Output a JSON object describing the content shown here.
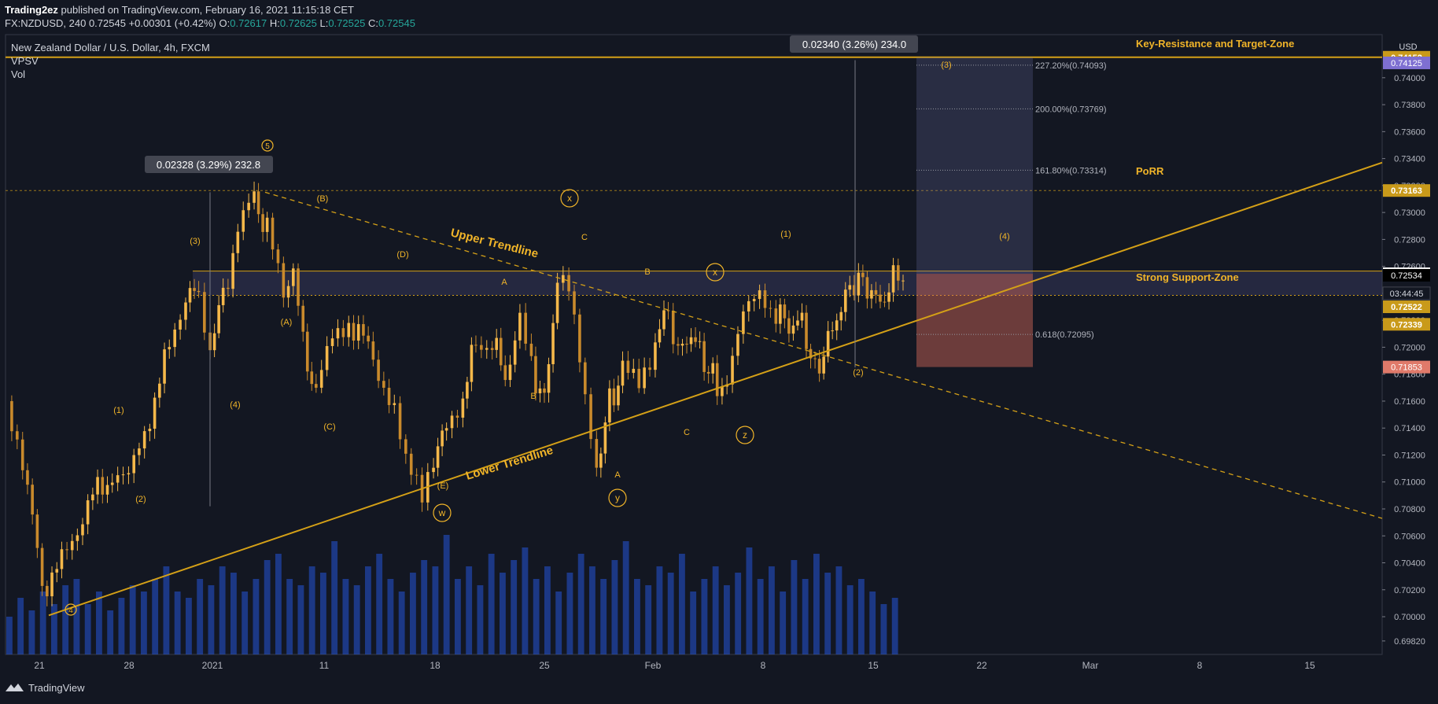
{
  "header": {
    "author": "Trading2ez",
    "published_text": "published on TradingView.com, February 16, 2021 11:15:18 CET",
    "symbol": "FX:NZDUSD, 240",
    "last": "0.72545",
    "change": "+0.00301 (+0.42%)",
    "o_label": "O:",
    "o": "0.72617",
    "h_label": "H:",
    "h": "0.72625",
    "l_label": "L:",
    "l": "0.72525",
    "c_label": "C:",
    "c": "0.72545"
  },
  "legend": {
    "title": "New Zealand Dollar / U.S. Dollar, 4h, FXCM",
    "indicator1": "VPSV",
    "indicator2": "Vol"
  },
  "footer": {
    "brand": "TradingView"
  },
  "colors": {
    "background": "#131722",
    "up_candle": "#f5b84a",
    "trendline": "#d4a017",
    "label_gold": "#f0b429",
    "volume": "#2962ff",
    "target_zone": "#6a6fa8",
    "stop_zone": "#d96a5a"
  },
  "chart_data": {
    "type": "candlestick",
    "symbol": "NZDUSD",
    "timeframe": "4h",
    "currency": "USD",
    "ylim": [
      0.6972,
      0.7432
    ],
    "x_ticks": [
      "21",
      "28",
      "2021",
      "11",
      "18",
      "25",
      "Feb",
      "8",
      "15",
      "22",
      "Mar",
      "8",
      "15"
    ],
    "y_ticks": [
      "0.74000",
      "0.73800",
      "0.73600",
      "0.73400",
      "0.73200",
      "0.73000",
      "0.72800",
      "0.72600",
      "0.72400",
      "0.72200",
      "0.72000",
      "0.71800",
      "0.71600",
      "0.71400",
      "0.71200",
      "0.71000",
      "0.70800",
      "0.70600",
      "0.70400",
      "0.70200",
      "0.70000",
      "0.69820"
    ],
    "price_tags": [
      {
        "value": "0.74152",
        "price": 0.74152,
        "kind": "gold"
      },
      {
        "value": "0.74125",
        "price": 0.7411,
        "kind": "purple"
      },
      {
        "value": "0.73163",
        "price": 0.73163,
        "kind": "gold"
      },
      {
        "value": "0.72545",
        "price": 0.72545,
        "kind": "white"
      },
      {
        "value": "03:44:45",
        "price": 0.724,
        "kind": "dark"
      },
      {
        "value": "0.72534",
        "price": 0.72534,
        "kind": "black"
      },
      {
        "value": "0.72522",
        "price": 0.723,
        "kind": "gold"
      },
      {
        "value": "0.72339",
        "price": 0.7217,
        "kind": "gold"
      },
      {
        "value": "0.71853",
        "price": 0.71853,
        "kind": "red"
      }
    ],
    "axis_currency": "USD",
    "price_path": [
      [
        0,
        0.716
      ],
      [
        10,
        0.712
      ],
      [
        22,
        0.7022
      ],
      [
        34,
        0.704
      ],
      [
        50,
        0.7085
      ],
      [
        65,
        0.7105
      ],
      [
        75,
        0.71
      ],
      [
        88,
        0.715
      ],
      [
        100,
        0.72
      ],
      [
        110,
        0.724
      ],
      [
        118,
        0.724
      ],
      [
        125,
        0.72
      ],
      [
        133,
        0.724
      ],
      [
        142,
        0.7285
      ],
      [
        152,
        0.731
      ],
      [
        160,
        0.7285
      ],
      [
        170,
        0.724
      ],
      [
        176,
        0.7262
      ],
      [
        182,
        0.72
      ],
      [
        190,
        0.7165
      ],
      [
        200,
        0.7205
      ],
      [
        210,
        0.722
      ],
      [
        225,
        0.7195
      ],
      [
        238,
        0.715
      ],
      [
        245,
        0.711
      ],
      [
        255,
        0.709
      ],
      [
        262,
        0.712
      ],
      [
        270,
        0.714
      ],
      [
        280,
        0.7165
      ],
      [
        288,
        0.7205
      ],
      [
        298,
        0.7205
      ],
      [
        306,
        0.718
      ],
      [
        315,
        0.7215
      ],
      [
        322,
        0.7185
      ],
      [
        330,
        0.716
      ],
      [
        338,
        0.725
      ],
      [
        345,
        0.724
      ],
      [
        355,
        0.716
      ],
      [
        362,
        0.711
      ],
      [
        370,
        0.716
      ],
      [
        378,
        0.718
      ],
      [
        388,
        0.7175
      ],
      [
        398,
        0.7205
      ],
      [
        406,
        0.723
      ],
      [
        412,
        0.7195
      ],
      [
        420,
        0.721
      ],
      [
        428,
        0.719
      ],
      [
        436,
        0.717
      ],
      [
        442,
        0.7178
      ],
      [
        452,
        0.722
      ],
      [
        462,
        0.724
      ],
      [
        472,
        0.7228
      ],
      [
        480,
        0.7215
      ],
      [
        488,
        0.722
      ],
      [
        496,
        0.718
      ],
      [
        504,
        0.7205
      ],
      [
        512,
        0.723
      ],
      [
        520,
        0.725
      ],
      [
        528,
        0.7245
      ],
      [
        536,
        0.7232
      ],
      [
        544,
        0.725
      ],
      [
        550,
        0.7255
      ]
    ],
    "volume": [
      0.3,
      0.45,
      0.35,
      0.5,
      0.4,
      0.55,
      0.6,
      0.4,
      0.5,
      0.35,
      0.45,
      0.55,
      0.5,
      0.6,
      0.7,
      0.5,
      0.45,
      0.6,
      0.55,
      0.7,
      0.65,
      0.5,
      0.6,
      0.75,
      0.8,
      0.6,
      0.55,
      0.7,
      0.65,
      0.9,
      0.6,
      0.55,
      0.7,
      0.8,
      0.6,
      0.5,
      0.65,
      0.75,
      0.7,
      0.95,
      0.6,
      0.7,
      0.55,
      0.8,
      0.65,
      0.75,
      0.85,
      0.6,
      0.7,
      0.5,
      0.65,
      0.8,
      0.7,
      0.6,
      0.75,
      0.9,
      0.6,
      0.55,
      0.7,
      0.65,
      0.8,
      0.5,
      0.6,
      0.7,
      0.55,
      0.65,
      0.85,
      0.6,
      0.7,
      0.5,
      0.75,
      0.6,
      0.8,
      0.65,
      0.7,
      0.55,
      0.6,
      0.5,
      0.4,
      0.45
    ],
    "lines": {
      "key_resistance": 0.74152,
      "porr": 0.73163,
      "support_top": 0.72565,
      "support_bottom": 0.72385
    },
    "annotations": {
      "measure1": "0.02328 (3.29%) 232.8",
      "measure2": "0.02340 (3.26%) 234.0",
      "fib_227": "227.20%(0.74093)",
      "fib_200": "200.00%(0.73769)",
      "fib_161": "161.80%(0.73314)",
      "fib_618": "0.618(0.72095)",
      "key_resistance_label": "Key-Resistance and Target-Zone",
      "porr_label": "PoRR",
      "support_label": "Strong Support-Zone",
      "upper_trendline": "Upper Trendline",
      "lower_trendline": "Lower Trendline"
    },
    "wave_labels": [
      {
        "t": "4",
        "circle": true
      },
      {
        "t": "(1)"
      },
      {
        "t": "(2)"
      },
      {
        "t": "(3)"
      },
      {
        "t": "(4)"
      },
      {
        "t": "5",
        "circle": true
      },
      {
        "t": "(A)"
      },
      {
        "t": "(B)"
      },
      {
        "t": "(C)"
      },
      {
        "t": "(D)"
      },
      {
        "t": "(E)"
      },
      {
        "t": "w",
        "circle": true
      },
      {
        "t": "A"
      },
      {
        "t": "B"
      },
      {
        "t": "C"
      },
      {
        "t": "x",
        "circle": true
      },
      {
        "t": "A"
      },
      {
        "t": "y",
        "circle": true
      },
      {
        "t": "B"
      },
      {
        "t": "C"
      },
      {
        "t": "x",
        "circle": true
      },
      {
        "t": "z",
        "circle": true
      },
      {
        "t": "(1)"
      },
      {
        "t": "(2)"
      },
      {
        "t": "(3)"
      },
      {
        "t": "(4)"
      }
    ]
  }
}
